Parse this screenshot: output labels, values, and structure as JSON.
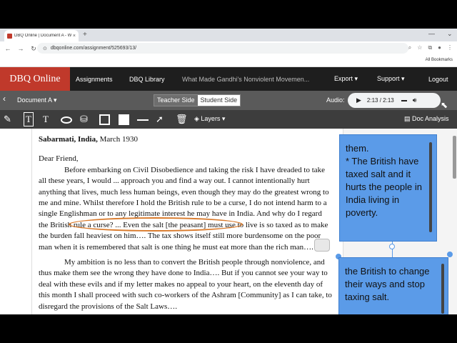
{
  "browser": {
    "tab_title": "DBQ Online | Document A - W",
    "tab_close": "×",
    "new_tab": "+",
    "url": "dbqonline.com/assignment/525693/13/",
    "all_bookmarks": "All Bookmarks"
  },
  "nav": {
    "logo": "DBQ Online",
    "assignments": "Assignments",
    "library": "DBQ Library",
    "title": "What Made Gandhi's Nonviolent Movemen...",
    "export": "Export ▾",
    "support": "Support ▾",
    "logout": "Logout"
  },
  "docbar": {
    "doc_select": "Document A ▾",
    "teacher": "Teacher Side",
    "student": "Student Side",
    "audio_label": "Audio:",
    "time": "2:13 / 2:13"
  },
  "tools": {
    "layers": "Layers ▾",
    "doc_analysis": "Doc Analysis"
  },
  "document": {
    "heading_bold": "Sabarmati, India,",
    "heading_date": " March 1930",
    "greeting": "Dear Friend,",
    "p1": "Before embarking on Civil Disobedience and taking the risk I have dreaded to take all these years, I would ... approach you and find a way out. I cannot intentionally hurt anything that lives, much less human beings, even though they may do the greatest wrong to me and mine. Whilst therefore I hold the British rule to be a curse, I do not intend harm to a single Englishman or to any legitimate interest he may have in India. And why do I regard the British rule a curse? ... Even the salt [the peasant] must use to live is so taxed as to make the burden fall heaviest on him…. The tax shows itself still more burdensome on the poor man when it is remembered that salt is one thing he must eat more than the rich man….",
    "p2": "My ambition is no less than to convert the British people through nonviolence, and thus make them see the wrong they have done to India…. But if you cannot see your way to deal with these evils and if my letter makes no appeal to your heart, on the eleventh day of this month I shall proceed with such co-workers of the Ashram [Community] as I can take, to disregard the provisions of the Salt Laws…."
  },
  "notes": [
    "them.\n* The British have taxed salt and it hurts the people in India living in poverty.",
    "the British to change their ways and stop taxing salt."
  ],
  "colors": {
    "logo_bg": "#c0392b",
    "note_bg": "#5b9be8",
    "annotation_circle": "#d97a2b"
  }
}
